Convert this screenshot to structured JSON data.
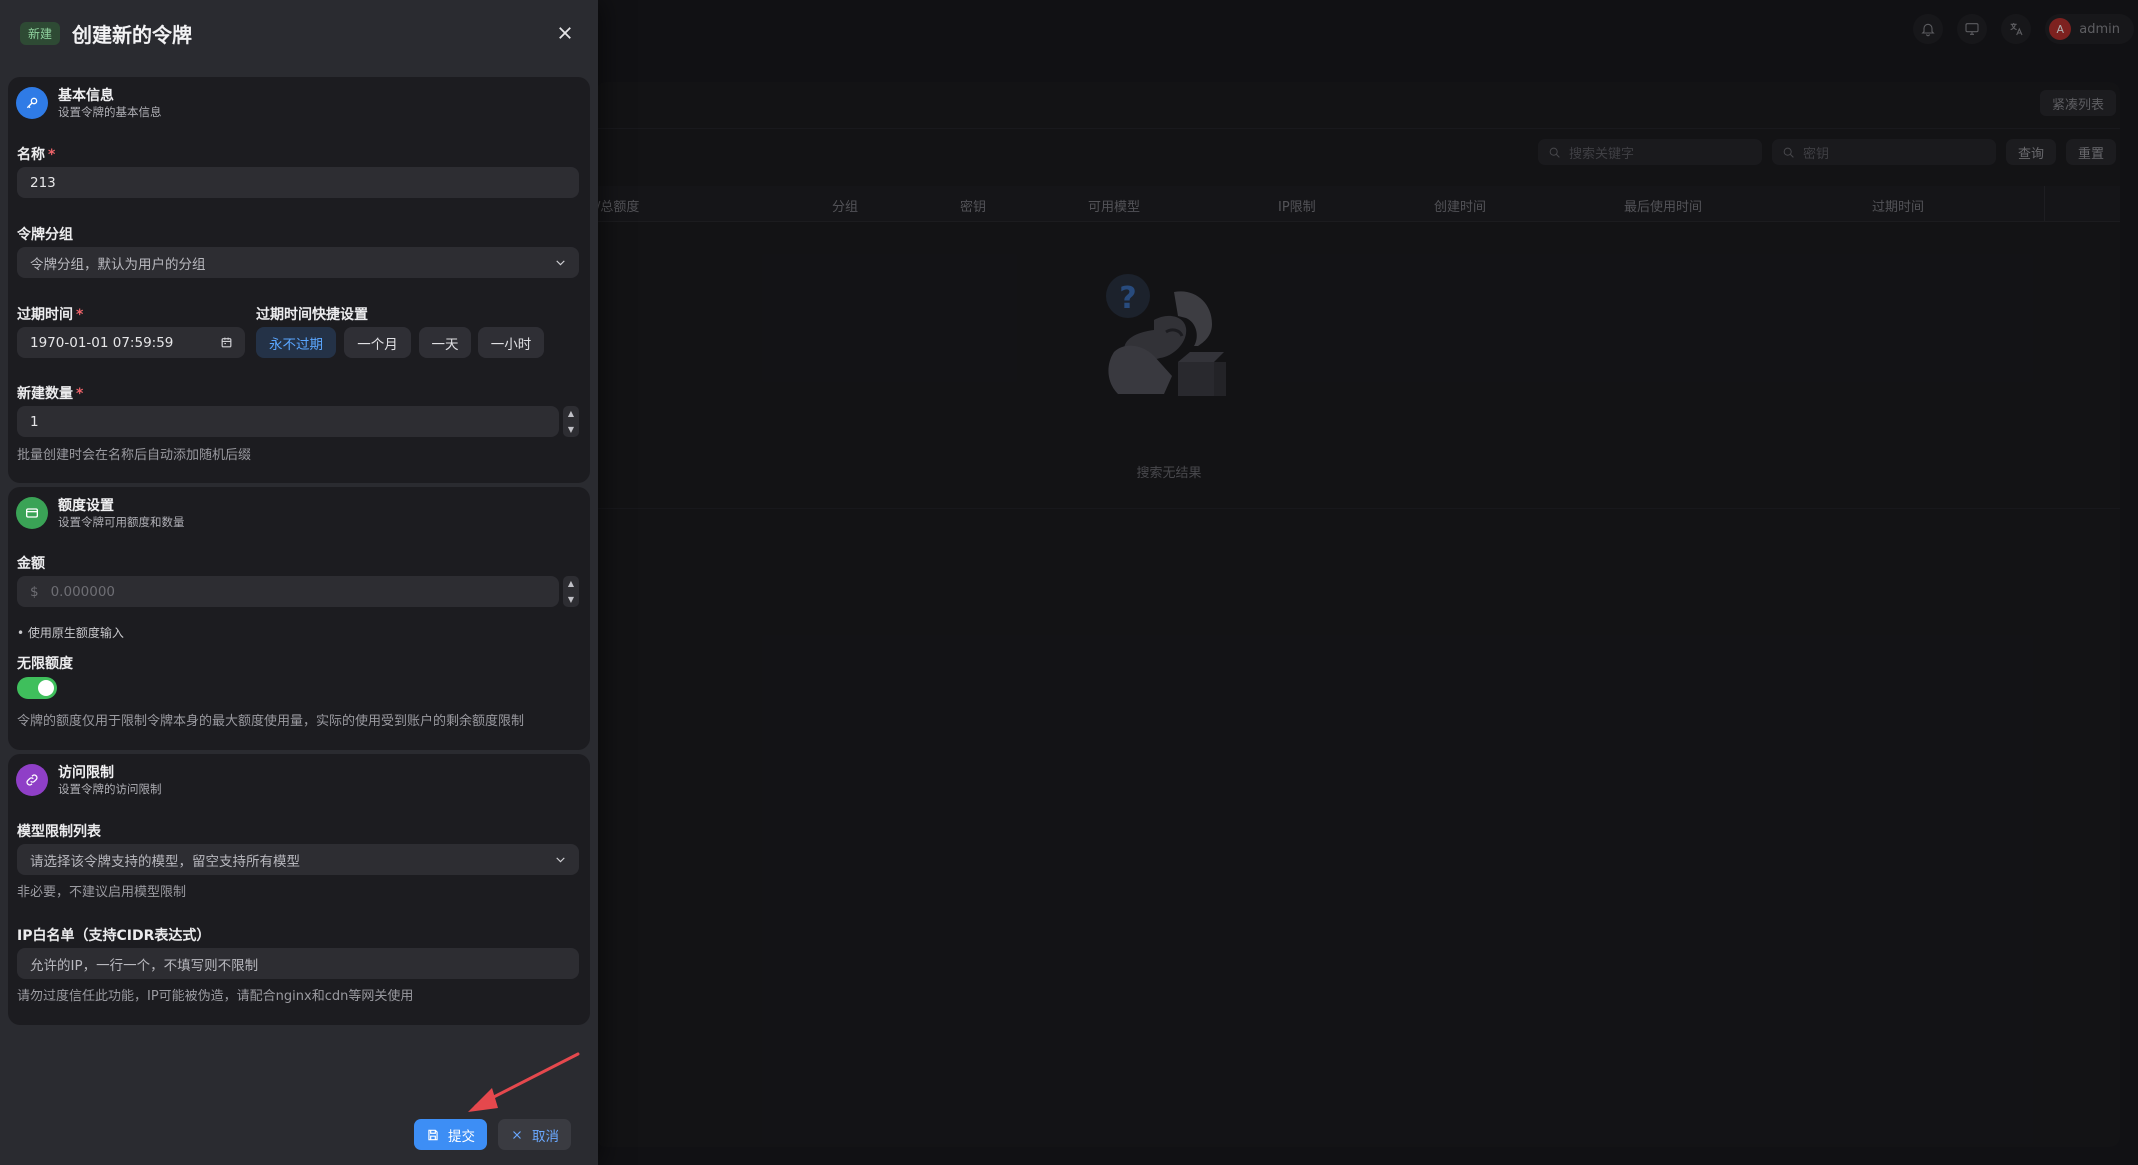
{
  "topbar": {
    "icons": [
      "bell-icon",
      "monitor-icon",
      "translate-icon"
    ],
    "avatar_letter": "A",
    "user_name": "admin"
  },
  "background": {
    "compact_label": "紧凑列表",
    "search_keyword_placeholder": "搜索关键字",
    "search_key_placeholder": "密钥",
    "query_label": "查询",
    "reset_label": "重置",
    "columns": [
      "/总额度",
      "分组",
      "密钥",
      "可用模型",
      "IP限制",
      "创建时间",
      "最后使用时间",
      "过期时间"
    ],
    "empty_text": "搜索无结果"
  },
  "sheet": {
    "tag": "新建",
    "title": "创建新的令牌",
    "basic": {
      "title": "基本信息",
      "subtitle": "设置令牌的基本信息",
      "name_label": "名称",
      "name_value": "213",
      "group_label": "令牌分组",
      "group_placeholder": "令牌分组，默认为用户的分组",
      "expire_label": "过期时间",
      "expire_value": "1970-01-01 07:59:59",
      "quick_label": "过期时间快捷设置",
      "quick_options": [
        "永不过期",
        "一个月",
        "一天",
        "一小时"
      ],
      "count_label": "新建数量",
      "count_value": "1",
      "count_help": "批量创建时会在名称后自动添加随机后缀"
    },
    "quota": {
      "title": "额度设置",
      "subtitle": "设置令牌可用额度和数量",
      "amount_label": "金额",
      "amount_prefix": "$",
      "amount_placeholder": "0.000000",
      "raw_input_link": "• 使用原生额度输入",
      "unlimited_label": "无限额度",
      "unlimited_on": true,
      "unlimited_help": "令牌的额度仅用于限制令牌本身的最大额度使用量，实际的使用受到账户的剩余额度限制"
    },
    "access": {
      "title": "访问限制",
      "subtitle": "设置令牌的访问限制",
      "models_label": "模型限制列表",
      "models_placeholder": "请选择该令牌支持的模型，留空支持所有模型",
      "models_help": "非必要，不建议启用模型限制",
      "ip_label": "IP白名单（支持CIDR表达式）",
      "ip_placeholder": "允许的IP，一行一个，不填写则不限制",
      "ip_help": "请勿过度信任此功能，IP可能被伪造，请配合nginx和cdn等网关使用"
    },
    "footer": {
      "submit_label": "提交",
      "cancel_label": "取消"
    }
  },
  "colors": {
    "primary": "#3d8ef5",
    "success": "#3fbf5c",
    "danger": "#f0646a",
    "basic_icon_bg": "#2f7be6",
    "quota_icon_bg": "#3aa356",
    "access_icon_bg": "#8f3fc7",
    "annotation_arrow": "#e5484d"
  }
}
